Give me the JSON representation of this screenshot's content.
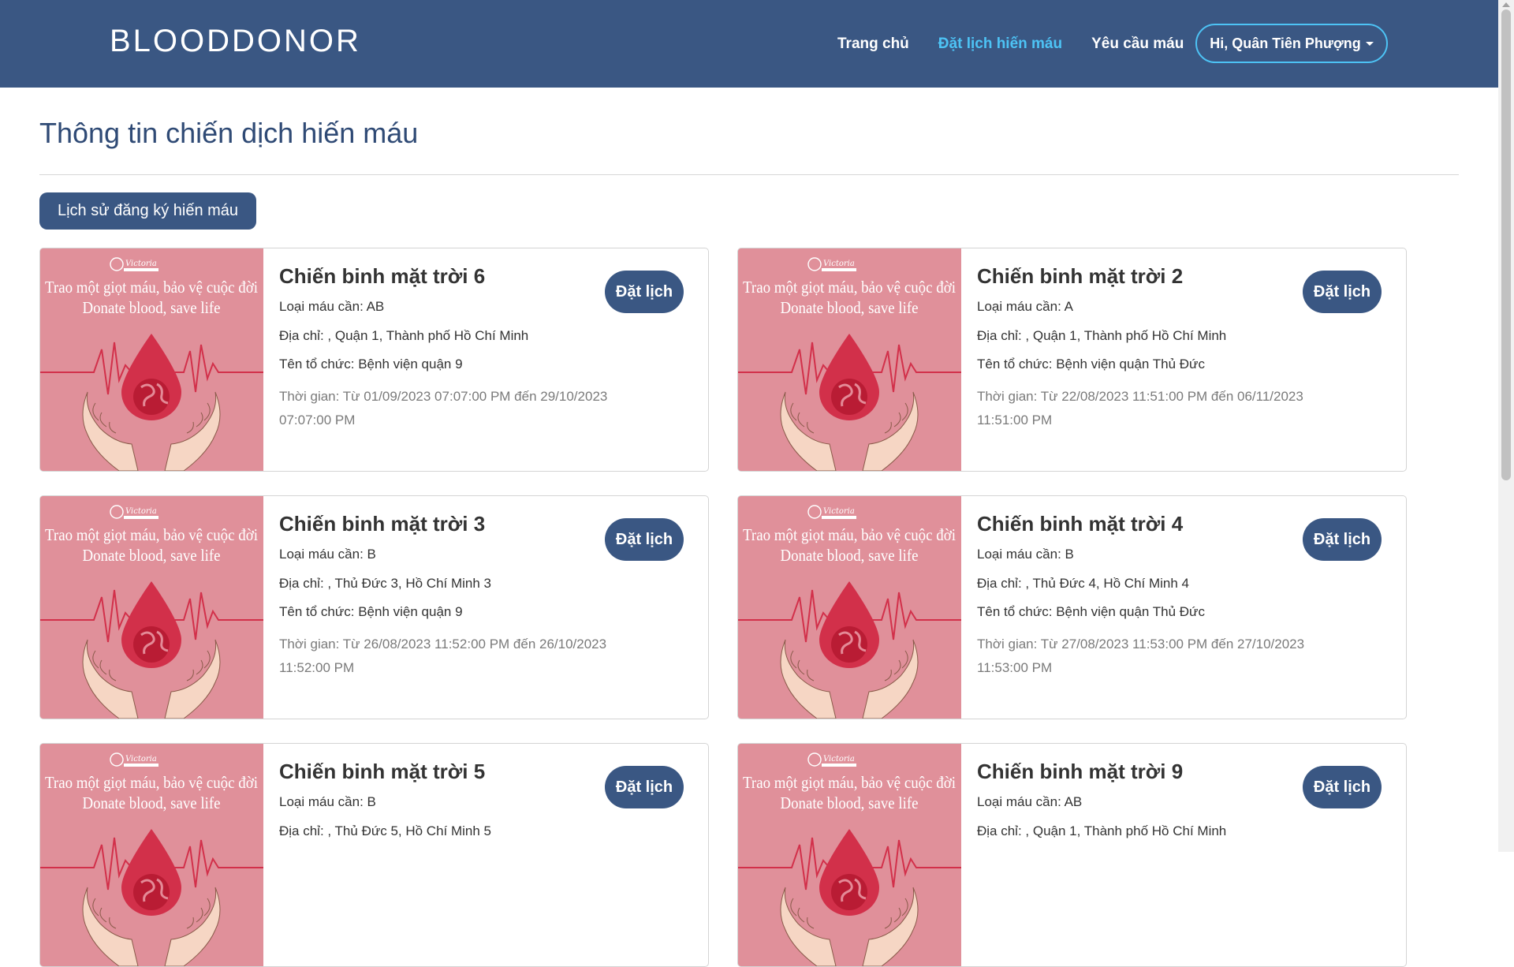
{
  "nav": {
    "brand": "BLOODDONOR",
    "links": [
      "Trang chủ",
      "Đặt lịch hiến máu",
      "Yêu cầu máu"
    ],
    "active_index": 1,
    "user_label": "Hi, Quân Tiên Phượng"
  },
  "page": {
    "title": "Thông tin chiến dịch hiến máu",
    "history_button": "Lịch sử đăng ký hiến máu"
  },
  "poster": {
    "logo_text": "Victoria",
    "line1": "Trao một giọt máu, bảo vệ cuộc đời",
    "line2": "Donate blood, save life"
  },
  "campaigns": [
    {
      "title": "Chiến binh mặt trời 6",
      "blood_type": "Loại máu cần: AB",
      "address": "Địa chỉ: , Quận 1, Thành phố Hồ Chí Minh",
      "organization": "Tên tổ chức: Bệnh viện quận 9",
      "time": "Thời gian: Từ 01/09/2023 07:07:00 PM đến 29/10/2023 07:07:00 PM",
      "button": "Đặt lịch"
    },
    {
      "title": "Chiến binh mặt trời 2",
      "blood_type": "Loại máu cần: A",
      "address": "Địa chỉ: , Quận 1, Thành phố Hồ Chí Minh",
      "organization": "Tên tổ chức: Bệnh viện quận Thủ Đức",
      "time": "Thời gian: Từ 22/08/2023 11:51:00 PM đến 06/11/2023 11:51:00 PM",
      "button": "Đặt lịch"
    },
    {
      "title": "Chiến binh mặt trời 3",
      "blood_type": "Loại máu cần: B",
      "address": "Địa chỉ: , Thủ Đức 3, Hồ Chí Minh 3",
      "organization": "Tên tổ chức: Bệnh viện quận 9",
      "time": "Thời gian: Từ 26/08/2023 11:52:00 PM đến 26/10/2023 11:52:00 PM",
      "button": "Đặt lịch"
    },
    {
      "title": "Chiến binh mặt trời 4",
      "blood_type": "Loại máu cần: B",
      "address": "Địa chỉ: , Thủ Đức 4, Hồ Chí Minh 4",
      "organization": "Tên tổ chức: Bệnh viện quận Thủ Đức",
      "time": "Thời gian: Từ 27/08/2023 11:53:00 PM đến 27/10/2023 11:53:00 PM",
      "button": "Đặt lịch"
    },
    {
      "title": "Chiến binh mặt trời 5",
      "blood_type": "Loại máu cần: B",
      "address": "Địa chỉ: , Thủ Đức 5, Hồ Chí Minh 5",
      "organization": "",
      "time": "",
      "button": "Đặt lịch"
    },
    {
      "title": "Chiến binh mặt trời 9",
      "blood_type": "Loại máu cần: AB",
      "address": "Địa chỉ: , Quận 1, Thành phố Hồ Chí Minh",
      "organization": "",
      "time": "",
      "button": "Đặt lịch"
    }
  ]
}
